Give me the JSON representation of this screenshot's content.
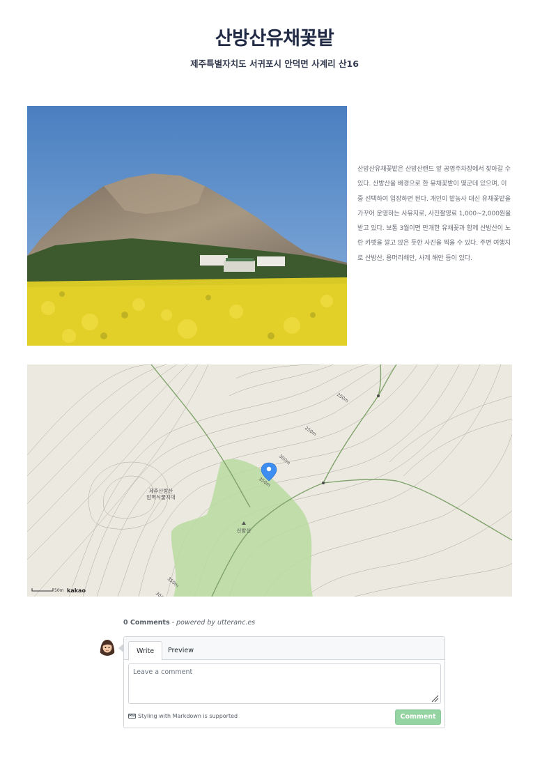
{
  "page": {
    "title": "산방산유채꽃밭",
    "address": "제주특별자치도 서귀포시 안덕면 사계리 산16",
    "description": "산방산유채꽃밭은 산방산랜드 앞 공영주차장에서 찾아갈 수 있다. 산방산을 배경으로 한 유채꽃밭이 몇군데 있으며, 이중 선택하여 입장하면 된다. 개인이 밭농사 대신 유채꽃밭을 가꾸어 운영하는 사유지로, 사진촬영료 1,000~2,000원을 받고 있다. 보통 3월이면 만개한 유채꽃과 함께 산방산이 노란 카펫을 깔고 앉은 듯한 사진을 찍을 수 있다. 주변 여행지로 산방산, 용머리해안, 사계 해안 등이 있다."
  },
  "map": {
    "labels": {
      "area_line1": "제주산방산",
      "area_line2": "암벽식물지대",
      "peak": "산방산",
      "c250a": "250m",
      "c250b": "250m",
      "c300a": "300m",
      "c350a": "350m",
      "c350b": "350m",
      "c300b": "300"
    },
    "scale_label": "50m",
    "brand": "kakao",
    "colors": {
      "background": "#ece9e1",
      "park": "#b9dba0",
      "road": "#7fa36a",
      "marker": "#3d8ef0"
    }
  },
  "comments": {
    "count_text": "0 Comments",
    "powered_text": "- powered by utteranc.es",
    "tab_write": "Write",
    "tab_preview": "Preview",
    "textarea_placeholder": "Leave a comment",
    "markdown_note": "Styling with Markdown is supported",
    "markdown_icon_text": "MD",
    "submit_label": "Comment",
    "submit_color": "#94d3a2"
  }
}
